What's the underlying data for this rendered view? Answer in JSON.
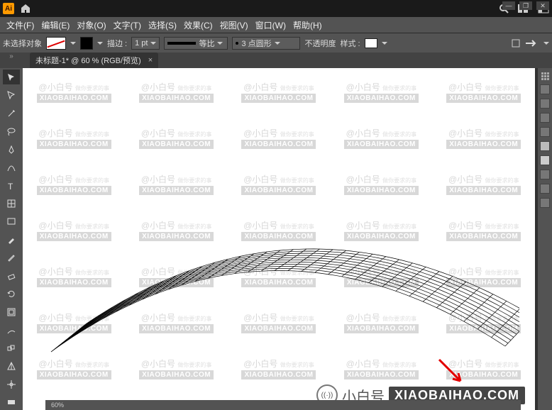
{
  "window": {
    "minimize": "—",
    "restore": "❐",
    "close": "✕"
  },
  "topbar": {
    "app_abbrev": "Ai"
  },
  "menu": {
    "file": "文件(F)",
    "edit": "编辑(E)",
    "object": "对象(O)",
    "type": "文字(T)",
    "select": "选择(S)",
    "effect": "效果(C)",
    "view": "视图(V)",
    "window": "窗口(W)",
    "help": "帮助(H)"
  },
  "controlbar": {
    "no_selection": "未选择对象",
    "stroke_label": "描边 :",
    "stroke_weight": "1 pt",
    "profile_label": "等比",
    "brush_label": "3 点圆形",
    "opacity_label": "不透明度",
    "style_label": "样式 :"
  },
  "tab": {
    "title": "未标题-1* @ 60 % (RGB/预览)",
    "close": "×"
  },
  "status": {
    "zoom": "60%",
    "other1": "",
    "other2": ""
  },
  "watermark": {
    "text_a": "@小白号",
    "text_a_sub": "做你要求的事",
    "text_b": "XIAOBAIHAO.COM",
    "big_label": "小白号",
    "big_pill": "XIAOBAIHAO.COM"
  },
  "tools": [
    "selection",
    "direct-selection",
    "magic-wand",
    "lasso",
    "pen",
    "curvature",
    "type",
    "line",
    "rectangle",
    "paintbrush",
    "pencil",
    "eraser",
    "rotate",
    "scale",
    "width",
    "free-transform",
    "shape-builder",
    "perspective",
    "mesh",
    "gradient"
  ]
}
